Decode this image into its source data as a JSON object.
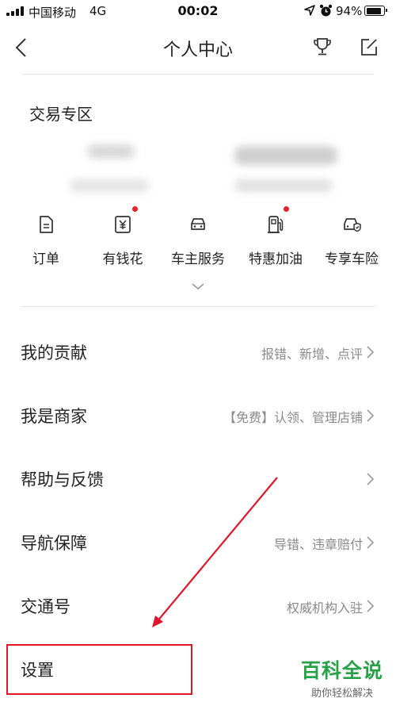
{
  "status_bar": {
    "carrier": "中国移动",
    "network": "4G",
    "time": "00:02",
    "battery_percent": "94%",
    "battery_level": 0.94,
    "icons": [
      "signal-icon",
      "location-icon",
      "alarm-icon",
      "battery-icon"
    ]
  },
  "nav": {
    "title": "个人中心",
    "icons": [
      "back-icon",
      "trophy-icon",
      "edit-icon"
    ]
  },
  "trade": {
    "title": "交易专区",
    "features": [
      {
        "label": "订单",
        "icon": "document-icon",
        "dot": false
      },
      {
        "label": "有钱花",
        "icon": "yuan-icon",
        "dot": true
      },
      {
        "label": "车主服务",
        "icon": "car-icon",
        "dot": false
      },
      {
        "label": "特惠加油",
        "icon": "fuel-icon",
        "dot": true
      },
      {
        "label": "专享车险",
        "icon": "car-insurance-icon",
        "dot": false
      }
    ]
  },
  "menu": [
    {
      "label": "我的贡献",
      "hint": "报错、新增、点评"
    },
    {
      "label": "我是商家",
      "hint": "【免费】认领、管理店铺"
    },
    {
      "label": "帮助与反馈",
      "hint": ""
    },
    {
      "label": "导航保障",
      "hint": "导错、违章赔付"
    },
    {
      "label": "交通号",
      "hint": "权威机构入驻"
    },
    {
      "label": "设置",
      "hint": ""
    }
  ],
  "colors": {
    "annotation_red": "#e2162a",
    "notification_dot": "#e5232a",
    "watermark_green": "#27a148"
  },
  "watermark": {
    "title": "百科全说",
    "subtitle": "助你轻松解决"
  }
}
